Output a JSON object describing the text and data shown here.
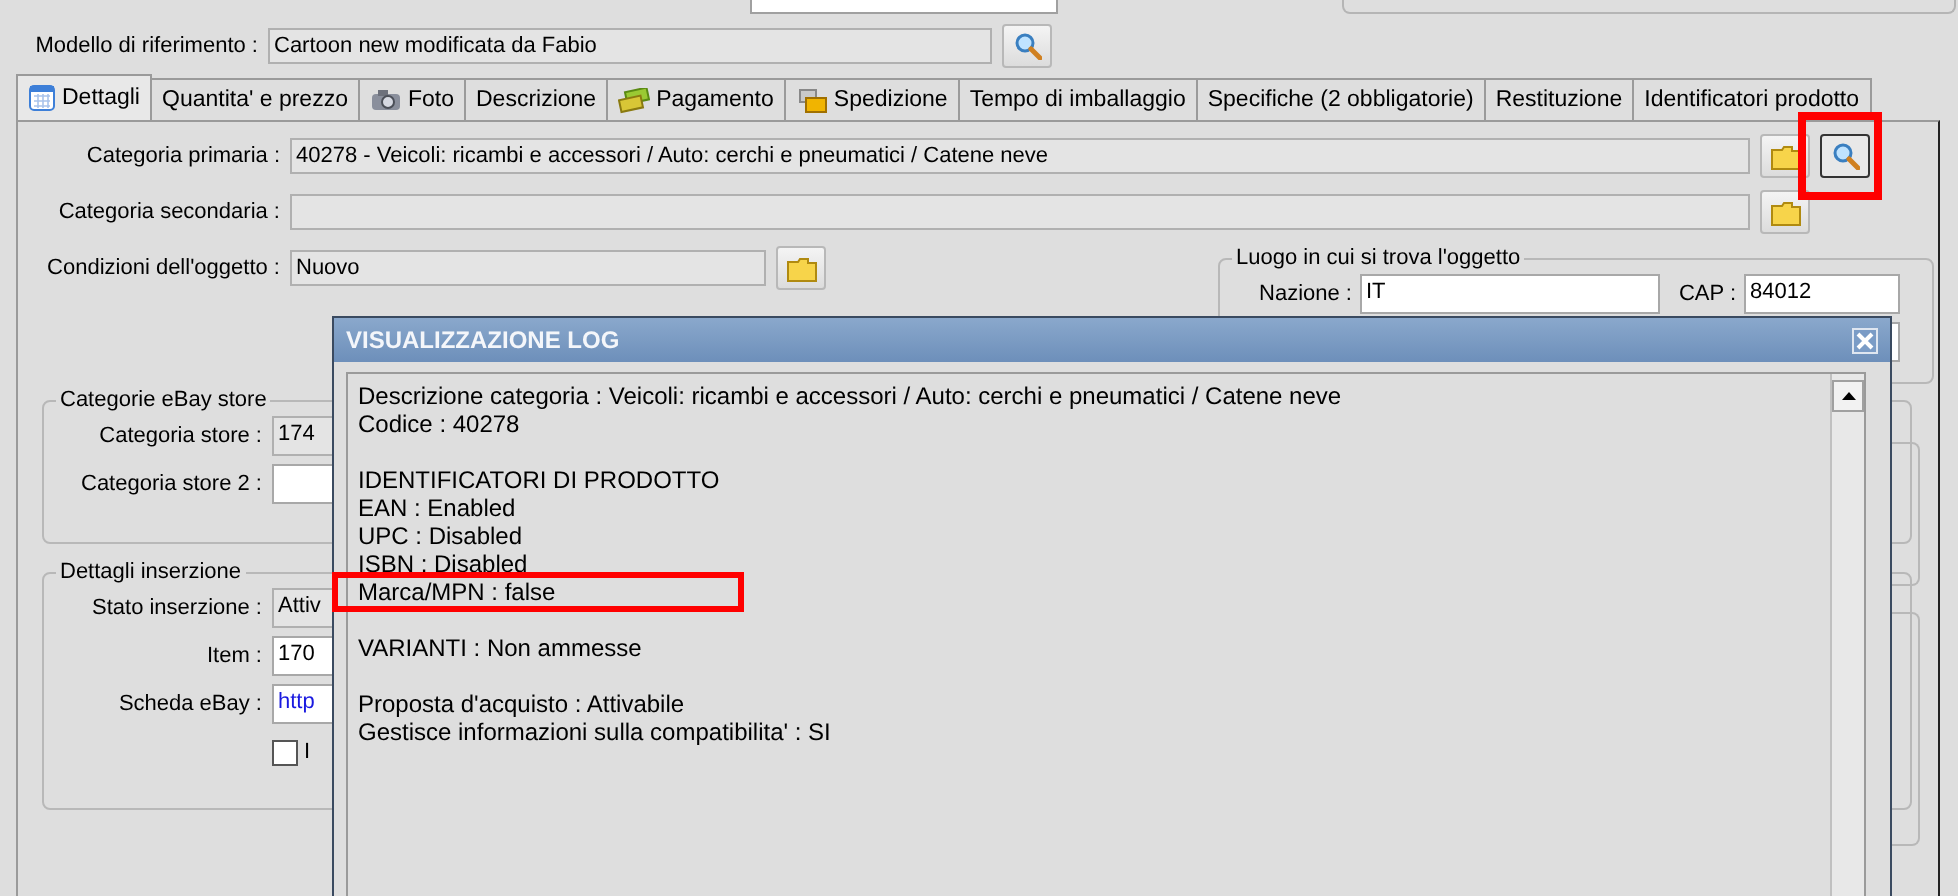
{
  "reference_model": {
    "label": "Modello di riferimento :",
    "value": "Cartoon new modificata da Fabio"
  },
  "tabs": [
    {
      "label": "Dettagli",
      "selected": true,
      "kind": "calendar"
    },
    {
      "label": "Quantita' e prezzo",
      "selected": false,
      "kind": "plain"
    },
    {
      "label": "Foto",
      "selected": false,
      "kind": "camera"
    },
    {
      "label": "Descrizione",
      "selected": false,
      "kind": "plain"
    },
    {
      "label": "Pagamento",
      "selected": false,
      "kind": "money"
    },
    {
      "label": "Spedizione",
      "selected": false,
      "kind": "parcel"
    },
    {
      "label": "Tempo di imballaggio",
      "selected": false,
      "kind": "plain"
    },
    {
      "label": "Specifiche (2 obbligatorie)",
      "selected": false,
      "kind": "plain"
    },
    {
      "label": "Restituzione",
      "selected": false,
      "kind": "plain"
    },
    {
      "label": "Identificatori prodotto",
      "selected": false,
      "kind": "plain"
    }
  ],
  "primary_category": {
    "label": "Categoria primaria :",
    "value": "40278 - Veicoli: ricambi e accessori / Auto: cerchi e pneumatici / Catene neve",
    "search_highlighted": true
  },
  "secondary_category": {
    "label": "Categoria secondaria :"
  },
  "condition": {
    "label": "Condizioni dell'oggetto :",
    "value": "Nuovo"
  },
  "location": {
    "title": "Luogo in cui si trova l'oggetto",
    "country_label": "Nazione :",
    "country": "IT",
    "zip_label": "CAP :",
    "zip": "84012"
  },
  "store": {
    "title": "Categorie eBay store",
    "fields": [
      {
        "label": "Categoria store :",
        "value": "174"
      },
      {
        "label": "Categoria store 2 :"
      }
    ]
  },
  "listing": {
    "title": "Dettagli inserzione",
    "fields": [
      {
        "label": "Stato inserzione :",
        "value": "Attiv",
        "kind": "grey"
      },
      {
        "label": "Item :",
        "value": "170",
        "kind": "text"
      },
      {
        "label": "Scheda eBay :",
        "value": "http",
        "kind": "link"
      }
    ],
    "checkbox": {
      "label": "I",
      "checked": false
    }
  },
  "log": {
    "title": "VISUALIZZAZIONE LOG",
    "paragraphs": [
      [
        {
          "text": "Descrizione categoria : Veicoli: ricambi e accessori / Auto: cerchi e pneumatici / Catene neve",
          "highlighted": false
        },
        {
          "text": "Codice : 40278",
          "highlighted": false
        }
      ],
      [
        {
          "text": "IDENTIFICATORI DI PRODOTTO",
          "highlighted": false
        },
        {
          "text": "EAN : Enabled",
          "highlighted": false
        },
        {
          "text": "UPC : Disabled",
          "highlighted": false
        },
        {
          "text": "ISBN : Disabled",
          "highlighted": false
        },
        {
          "text": "Marca/MPN : false",
          "highlighted": true
        }
      ],
      [
        {
          "text": "VARIANTI : Non ammesse",
          "highlighted": false
        }
      ],
      [
        {
          "text": "Proposta d'acquisto : Attivabile",
          "highlighted": false
        },
        {
          "text": "Gestisce informazioni sulla compatibilita' : SI",
          "highlighted": false
        }
      ]
    ]
  }
}
